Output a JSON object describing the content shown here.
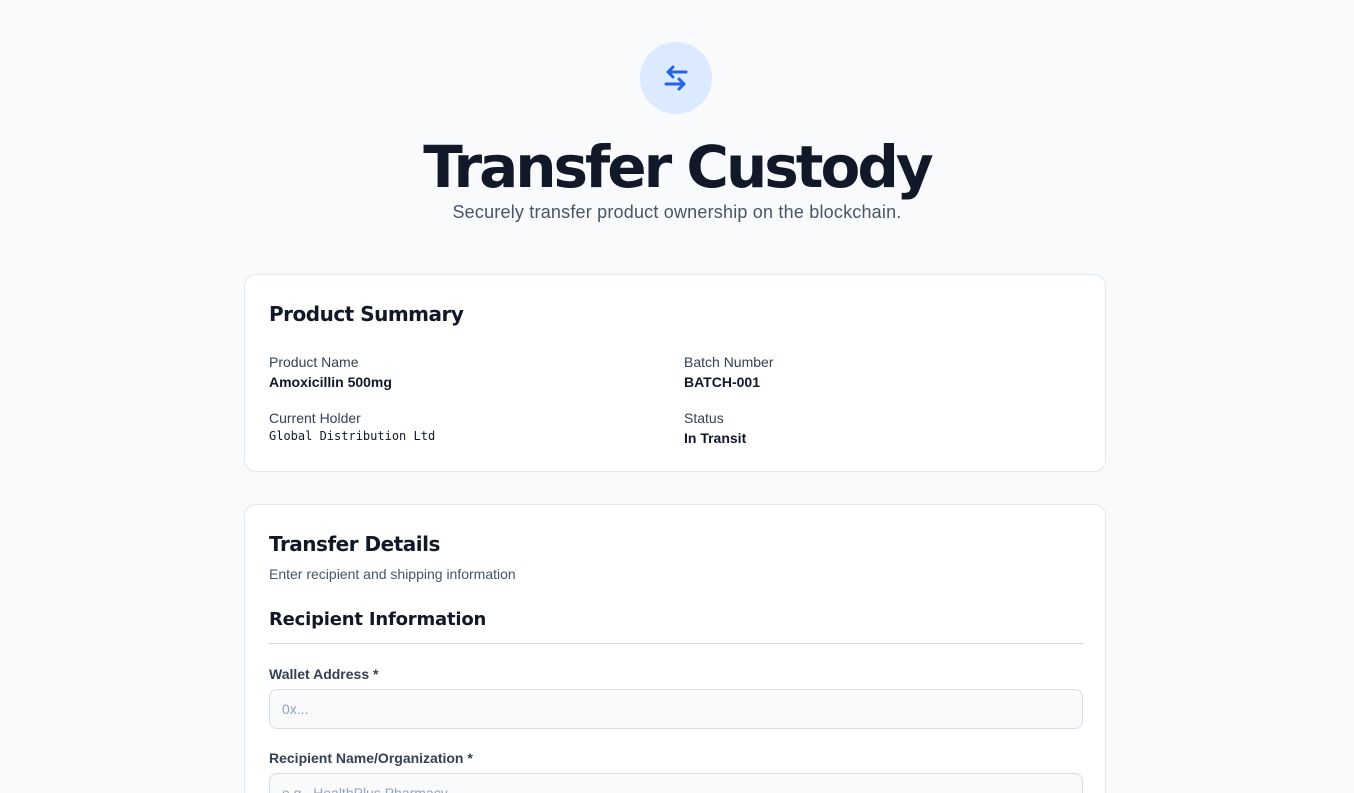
{
  "hero": {
    "icon": "transfer-arrows-icon",
    "title": "Transfer Custody",
    "subtitle": "Securely transfer product ownership on the blockchain.",
    "accent_color": "#2563eb",
    "icon_bg_color": "#dbeafe"
  },
  "product_summary": {
    "title": "Product Summary",
    "fields": [
      {
        "label": "Product Name",
        "value": "Amoxicillin 500mg"
      },
      {
        "label": "Batch Number",
        "value": "BATCH-001"
      },
      {
        "label": "Current Holder",
        "value": "Global Distribution Ltd"
      },
      {
        "label": "Status",
        "value": "In Transit"
      }
    ]
  },
  "transfer_details": {
    "title": "Transfer Details",
    "subtitle": "Enter recipient and shipping information",
    "recipient_section": {
      "heading": "Recipient Information",
      "wallet": {
        "label": "Wallet Address *",
        "value": "",
        "placeholder": "0x..."
      },
      "recipient_name": {
        "label": "Recipient Name/Organization *",
        "value": "",
        "placeholder": "e.g., HealthPlus Pharmacy"
      }
    }
  }
}
